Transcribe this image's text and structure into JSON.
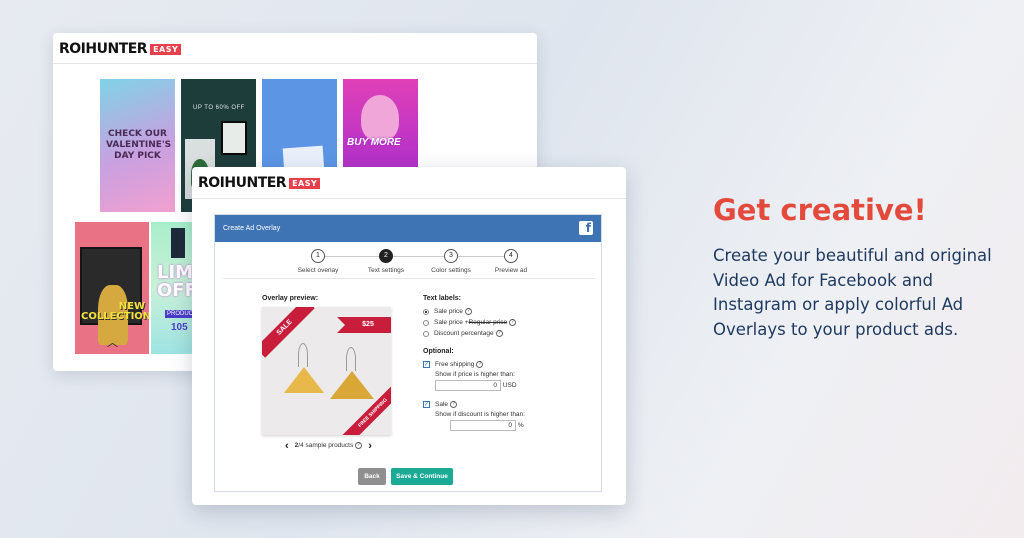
{
  "back_window": {
    "logo_main": "ROIHUNTER",
    "logo_badge": "EASY",
    "tiles": {
      "t1_text": "CHECK OUR VALENTINE'S DAY PICK",
      "t2_text": "UP TO 60% OFF",
      "t4_text": "BUY MORE",
      "t5_text": "NEW COLLECTION",
      "t6_big": "LIMI OFF",
      "t6_small": "PRODUCT",
      "t6_num": "105"
    }
  },
  "front_window": {
    "logo_main": "ROIHUNTER",
    "logo_badge": "EASY",
    "panel_title": "Create Ad Overlay",
    "fb_icon": "facebook-icon",
    "steps": [
      {
        "num": "1",
        "label": "Select overlay"
      },
      {
        "num": "2",
        "label": "Text settings"
      },
      {
        "num": "3",
        "label": "Color settings"
      },
      {
        "num": "4",
        "label": "Preview ad"
      }
    ],
    "preview_label": "Overlay preview:",
    "ribbons": {
      "sale": "SALE",
      "price": "$25",
      "shipping": "FREE SHIPPING"
    },
    "pager": {
      "current": "2",
      "text": "/4 sample products"
    },
    "text_labels": {
      "heading": "Text labels:",
      "opt1": "Sale price",
      "opt2_a": "Sale price + ",
      "opt2_b": "Regular price",
      "opt3": "Discount percentage"
    },
    "optional": {
      "heading": "Optional:",
      "free_shipping": "Free shipping",
      "ship_hint": "Show if price is higher than:",
      "ship_value": "0",
      "ship_unit": "USD",
      "sale": "Sale",
      "sale_hint": "Show if discount is higher than:",
      "sale_value": "0",
      "sale_unit": "%"
    },
    "buttons": {
      "back": "Back",
      "save": "Save & Continue"
    }
  },
  "copy": {
    "headline": "Get creative!",
    "body": "Create your beautiful and original Video Ad for Facebook and Instagram or apply colorful Ad Overlays to your product ads."
  },
  "colors": {
    "brand_red": "#e34a3c",
    "panel_blue": "#3e73b4",
    "save_green": "#1aaa96",
    "copy_navy": "#1f3a60"
  }
}
